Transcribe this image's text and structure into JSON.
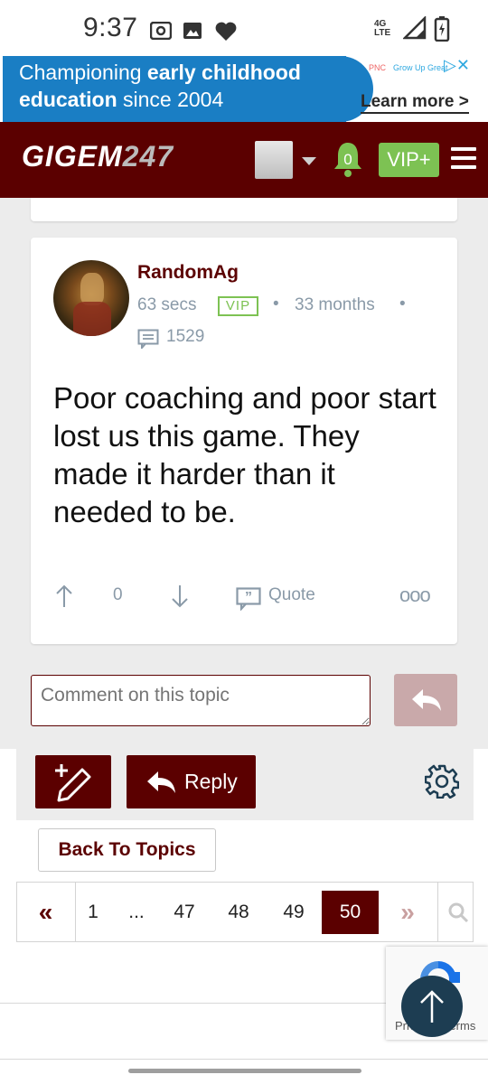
{
  "status_bar": {
    "time": "9:37",
    "network": "4G LTE"
  },
  "ad": {
    "line1_regular": "Championing ",
    "line1_bold": "early childhood",
    "line2_bold": "education",
    "line2_regular": " since 2004",
    "brand_left": "PNC",
    "brand_right": "Grow Up Great",
    "cta": "Learn more >"
  },
  "header": {
    "logo_main": "GIGEM",
    "logo_num": "247",
    "notification_count": "0",
    "vip_label": "VIP+"
  },
  "post": {
    "username": "RandomAg",
    "time_ago": "63 secs",
    "badge": "VIP",
    "member_for": "33 months",
    "post_count": "1529",
    "body": "Poor coaching and poor start lost us this game. They made it harder than it needed to be.",
    "vote_count": "0",
    "quote_label": "Quote",
    "more_label": "ooo"
  },
  "composer": {
    "placeholder": "Comment on this topic"
  },
  "actions": {
    "reply_label": "Reply",
    "back_label": "Back To Topics"
  },
  "pagination": {
    "first": "«",
    "pages": [
      "1",
      "...",
      "47",
      "48",
      "49"
    ],
    "current": "50",
    "next": "»"
  },
  "recaptcha": {
    "text": "Privacy - Terms"
  },
  "colors": {
    "brand": "#5b0000",
    "vip_green": "#7dc253",
    "meta_gray": "#8a9aa8"
  }
}
